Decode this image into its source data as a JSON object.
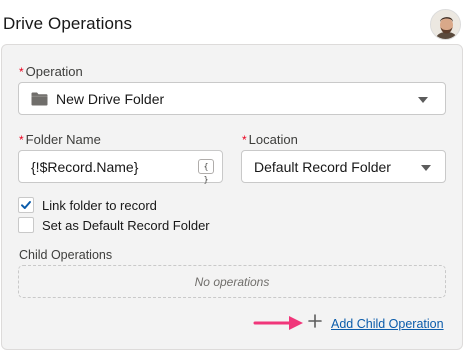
{
  "header": {
    "title": "Drive Operations"
  },
  "form": {
    "operation": {
      "label": "Operation",
      "value": "New Drive Folder"
    },
    "folder_name": {
      "label": "Folder Name",
      "value": "{!$Record.Name}",
      "merge_icon": "{ }"
    },
    "location": {
      "label": "Location",
      "value": "Default Record Folder"
    },
    "link_folder": {
      "label": "Link folder to record",
      "checked": true
    },
    "default_folder": {
      "label": "Set as Default Record Folder",
      "checked": false
    },
    "child_operations": {
      "label": "Child Operations",
      "empty_text": "No operations"
    },
    "add_child": {
      "label": "Add Child Operation"
    },
    "required_marker": "*"
  },
  "colors": {
    "accent": "#0b5cab",
    "required": "#ea001e",
    "annotation_arrow": "#f0367a"
  }
}
